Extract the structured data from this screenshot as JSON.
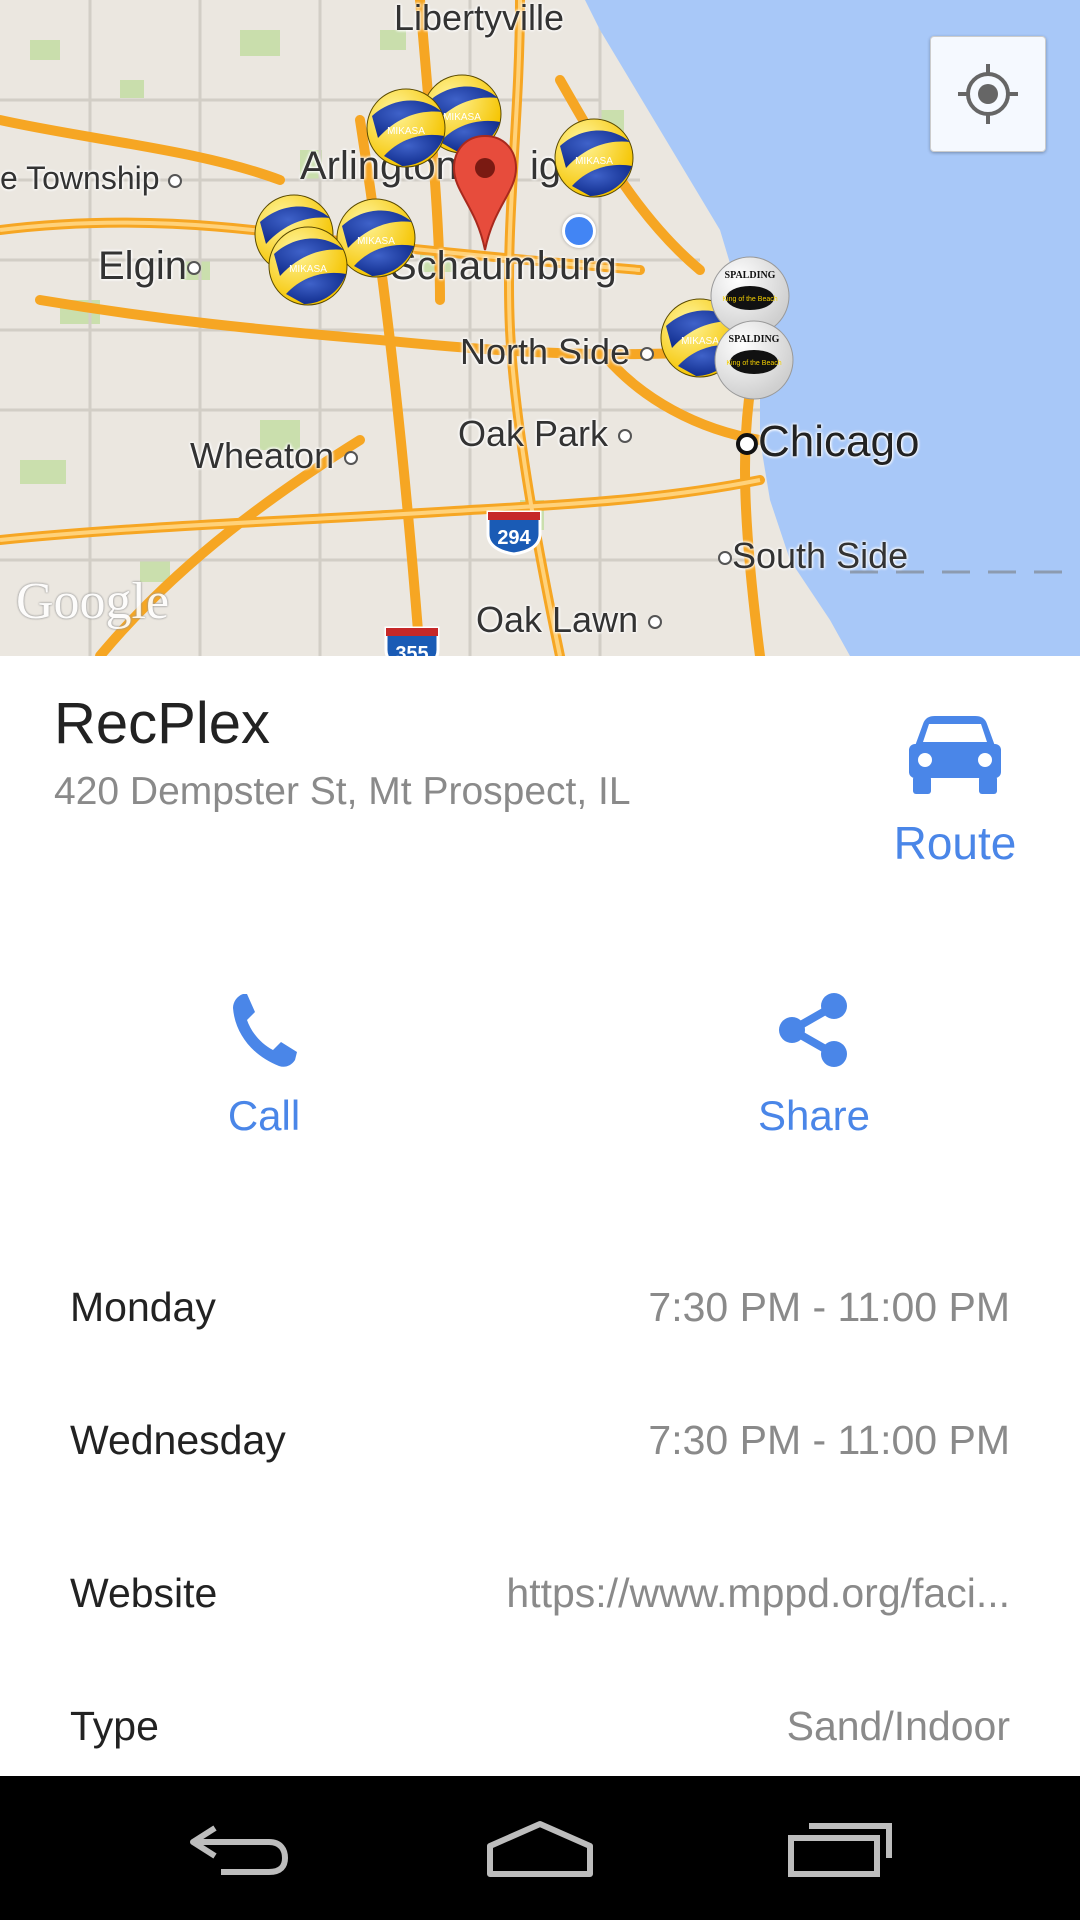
{
  "map": {
    "cities": {
      "libertyville": "Libertyville",
      "township": "e Township",
      "arlington": "Arlington",
      "heights": "ig",
      "elgin": "Elgin",
      "schaumburg": "Schaumburg",
      "north_side": "North Side",
      "oak_park": "Oak Park",
      "wheaton": "Wheaton",
      "chicago": "Chicago",
      "south_side": "South Side",
      "oak_lawn": "Oak Lawn"
    },
    "highways": {
      "i294": "294",
      "i355": "355"
    },
    "attribution": "Google",
    "ball_brands": {
      "mikasa": "MIKASA",
      "spalding": "SPALDING",
      "king_of_beach": "King of the Beach"
    },
    "colors": {
      "water": "#a8c8f8",
      "land": "#ebe7e0",
      "road": "#f6a623",
      "park": "#c6dea7"
    }
  },
  "place": {
    "name": "RecPlex",
    "address": "420 Dempster St, Mt Prospect, IL"
  },
  "actions": {
    "route": "Route",
    "call": "Call",
    "share": "Share"
  },
  "details": [
    {
      "key": "Monday",
      "value": "7:30 PM - 11:00 PM"
    },
    {
      "key": "Wednesday",
      "value": "7:30 PM - 11:00 PM"
    },
    {
      "key": "Website",
      "value": "https://www.mppd.org/faci..."
    },
    {
      "key": "Type",
      "value": "Sand/Indoor"
    }
  ],
  "theme": {
    "accent": "#4a86e8"
  }
}
